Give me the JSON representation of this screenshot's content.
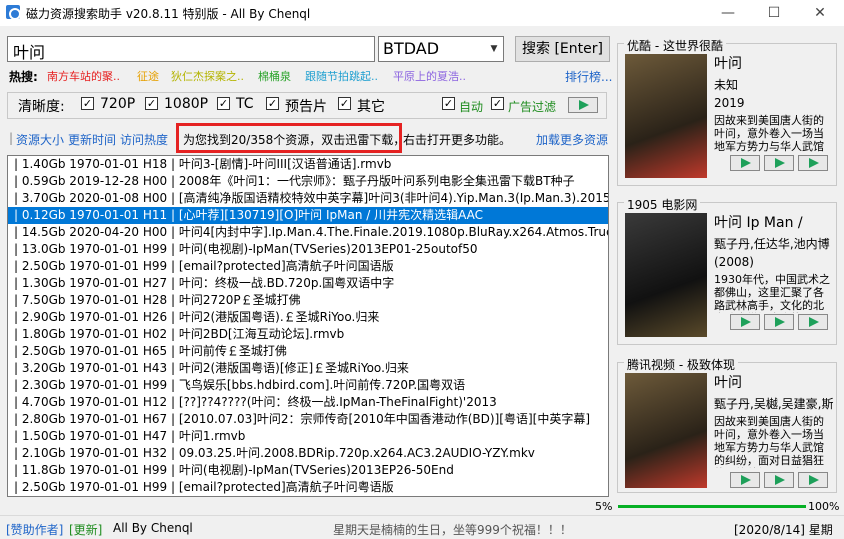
{
  "window": {
    "title": "磁力资源搜索助手 v20.8.11 特别版 - All By Chenql",
    "minimize": "—",
    "maximize": "☐",
    "close": "✕"
  },
  "search": {
    "query": "叶问",
    "site": "BTDAD",
    "button": "搜索 [Enter]"
  },
  "hot": {
    "label": "热搜:",
    "items": [
      {
        "text": "南方车站的聚..",
        "color": "#e62020"
      },
      {
        "text": "征途",
        "color": "#e6a000"
      },
      {
        "text": "狄仁杰探案之..",
        "color": "#b4b400"
      },
      {
        "text": "棉桶泉",
        "color": "#2aa32a"
      },
      {
        "text": "跟随节拍跳起..",
        "color": "#20a0d0"
      },
      {
        "text": "平原上的夏浩..",
        "color": "#8c64e0"
      }
    ],
    "rank_link": "排行榜..."
  },
  "filters": {
    "label": "清晰度:",
    "options": [
      {
        "label": "720P",
        "checked": true
      },
      {
        "label": "1080P",
        "checked": true
      },
      {
        "label": "TC",
        "checked": true
      },
      {
        "label": "预告片",
        "checked": true
      },
      {
        "label": "其它",
        "checked": true
      }
    ],
    "auto_label": "自动",
    "ad_filter_label": "广告过滤"
  },
  "links": {
    "size": "资源大小",
    "update_time": "更新时间",
    "visits": "访问热度",
    "status": "为您找到20/358个资源，双击迅雷下载，",
    "status_tail": "右击打开更多功能。",
    "more": "加载更多资源"
  },
  "results": [
    "| 1.40Gb 1970-01-01 H18 | 叶问3-[剧情]-叶问III[汉语普通话].rmvb",
    "| 0.59Gb 2019-12-28 H00 | 2008年《叶问1：一代宗师》：甄子丹版叶问系列电影全集迅雷下载BT种子",
    "| 3.70Gb 2020-01-08 H00 | [高清纯净版国语精校特效中英字幕]叶问3(非叶问4).Yip.Man.3(Ip.Man.3).2015.HD",
    "| 0.12Gb 1970-01-01 H11 | [心叶荐][130719][O]叶问 IpMan / 川井宪次精选辑AAC",
    "| 14.5Gb 2020-04-20 H00 | 叶问4[内封中字].Ip.Man.4.The.Finale.2019.1080p.BluRay.x264.Atmos.TrueHD7",
    "| 13.0Gb 1970-01-01 H99 | 叶问(电视剧)-IpMan(TVSeries)2013EP01-25outof50",
    "| 2.50Gb 1970-01-01 H99 | [email?protected]高清航子叶问国语版",
    "| 1.30Gb 1970-01-01 H27 | 叶问：终极一战.BD.720p.国粤双语中字",
    "| 7.50Gb 1970-01-01 H28 | 叶问2720P￡圣城打佛",
    "| 2.90Gb 1970-01-01 H26 | 叶问2(港版国粤语).￡圣城RiYoo.归来",
    "| 1.80Gb 1970-01-01 H02 | 叶问2BD[江海互动论坛].rmvb",
    "| 2.50Gb 1970-01-01 H65 | 叶问前传￡圣城打佛",
    "| 3.20Gb 1970-01-01 H43 | 叶问2(港版国粤语)[修正]￡圣城RiYoo.归来",
    "| 2.30Gb 1970-01-01 H99 | 飞鸟娱乐[bbs.hdbird.com].叶问前传.720P.国粤双语",
    "| 4.70Gb 1970-01-01 H12 | [??]??4????(叶问：终极一战.IpMan-TheFinalFight)'2013",
    "| 2.80Gb 1970-01-01 H67 | [2010.07.03]叶问2：宗师传奇[2010年中国香港动作(BD)][粤语][中英字幕]",
    "| 1.50Gb 1970-01-01 H47 | 叶问1.rmvb",
    "| 2.10Gb 1970-01-01 H32 | 09.03.25.叶问.2008.BDRip.720p.x264.AC3.2AUDIO-YZY.mkv",
    "| 11.8Gb 1970-01-01 H99 | 叶问(电视剧)-IpMan(TVSeries)2013EP26-50End",
    "| 2.50Gb 1970-01-01 H99 | [email?protected]高清航子叶问粤语版"
  ],
  "selected_index": 3,
  "progress": {
    "left_label": "5%",
    "left_value": 0.05,
    "right_label": "100%",
    "right_value": 1.0
  },
  "statusbar": {
    "sponsor": "[赞助作者]",
    "update": "[更新]",
    "author": "All By Chenql",
    "message": "星期天是楠楠的生日，坐等999个祝福！！！",
    "date": "[2020/8/14] 星期五"
  },
  "panels": [
    {
      "title": "优酷 - 这世界很酷",
      "name": "叶问",
      "info": [
        "未知",
        "2019"
      ],
      "desc": "因故来到美国唐人街的叶问，意外卷入一场当地军方势力与华人武馆"
    },
    {
      "title": "1905 电影网",
      "name": "叶问 Ip Man /",
      "info": [
        "甄子丹,任达华,池内博",
        "(2008)"
      ],
      "desc": "1930年代，中国武术之都佛山，这里汇聚了各路武林高手，文化的北方武术掌门金山找"
    },
    {
      "title": "腾讯视频 - 极致体现",
      "name": "叶问",
      "info": [
        "甄子丹,吴樾,吴建豪,斯"
      ],
      "desc": "因故来到美国唐人街的叶问，意外卷入一场当地军方势力与华人武馆的纠纷，面对日益猖狂的民族歧视与压迫，叶"
    }
  ]
}
